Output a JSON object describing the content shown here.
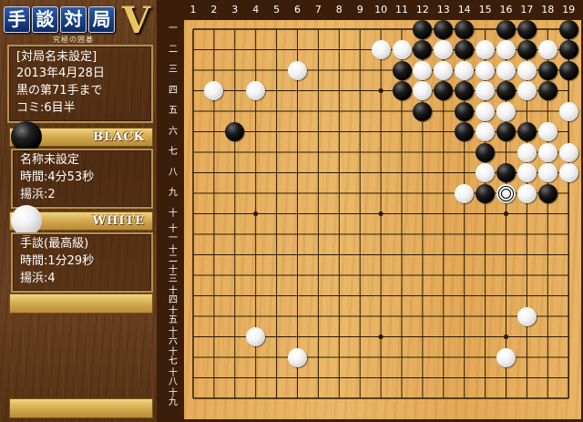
{
  "logo": {
    "title_chars": [
      "手",
      "談",
      "対",
      "局"
    ],
    "version": "V",
    "subtitle": "究極の囲碁"
  },
  "game_info": {
    "match_name": "[対局名未設定]",
    "date": "2013年4月28日",
    "move_status": "黒の第71手まで",
    "komi": "コミ:6目半"
  },
  "black_player": {
    "color_label": "BLACK",
    "name": "名称未設定",
    "time": "時間:4分53秒",
    "captures": "揚浜:2"
  },
  "white_player": {
    "color_label": "WHITE",
    "name": "手談(最高級)",
    "time": "時間:1分29秒",
    "captures": "揚浜:4"
  },
  "board": {
    "size": 19,
    "col_labels": [
      "1",
      "2",
      "3",
      "4",
      "5",
      "6",
      "7",
      "8",
      "9",
      "10",
      "11",
      "12",
      "13",
      "14",
      "15",
      "16",
      "17",
      "18",
      "19"
    ],
    "row_labels": [
      "一",
      "二",
      "三",
      "四",
      "五",
      "六",
      "七",
      "八",
      "九",
      "十",
      "十一",
      "十二",
      "十三",
      "十四",
      "十五",
      "十六",
      "十七",
      "十八",
      "十九"
    ],
    "stones": {
      "black": [
        [
          12,
          1
        ],
        [
          13,
          1
        ],
        [
          14,
          1
        ],
        [
          16,
          1
        ],
        [
          17,
          1
        ],
        [
          19,
          1
        ],
        [
          12,
          2
        ],
        [
          14,
          2
        ],
        [
          17,
          2
        ],
        [
          19,
          2
        ],
        [
          11,
          3
        ],
        [
          18,
          3
        ],
        [
          19,
          3
        ],
        [
          11,
          4
        ],
        [
          13,
          4
        ],
        [
          14,
          4
        ],
        [
          16,
          4
        ],
        [
          18,
          4
        ],
        [
          12,
          5
        ],
        [
          14,
          5
        ],
        [
          3,
          6
        ],
        [
          14,
          6
        ],
        [
          16,
          6
        ],
        [
          17,
          6
        ],
        [
          15,
          7
        ],
        [
          16,
          8
        ],
        [
          15,
          9
        ],
        [
          18,
          9
        ]
      ],
      "white": [
        [
          10,
          2
        ],
        [
          11,
          2
        ],
        [
          13,
          2
        ],
        [
          15,
          2
        ],
        [
          16,
          2
        ],
        [
          18,
          2
        ],
        [
          6,
          3
        ],
        [
          12,
          3
        ],
        [
          13,
          3
        ],
        [
          14,
          3
        ],
        [
          15,
          3
        ],
        [
          16,
          3
        ],
        [
          17,
          3
        ],
        [
          2,
          4
        ],
        [
          4,
          4
        ],
        [
          12,
          4
        ],
        [
          15,
          4
        ],
        [
          17,
          4
        ],
        [
          15,
          5
        ],
        [
          16,
          5
        ],
        [
          19,
          5
        ],
        [
          15,
          6
        ],
        [
          18,
          6
        ],
        [
          17,
          7
        ],
        [
          18,
          7
        ],
        [
          19,
          7
        ],
        [
          15,
          8
        ],
        [
          17,
          8
        ],
        [
          18,
          8
        ],
        [
          19,
          8
        ],
        [
          14,
          9
        ],
        [
          16,
          9
        ],
        [
          17,
          9
        ],
        [
          17,
          15
        ],
        [
          4,
          16
        ],
        [
          6,
          17
        ],
        [
          16,
          17
        ]
      ]
    },
    "last_move": [
      16,
      9
    ]
  }
}
